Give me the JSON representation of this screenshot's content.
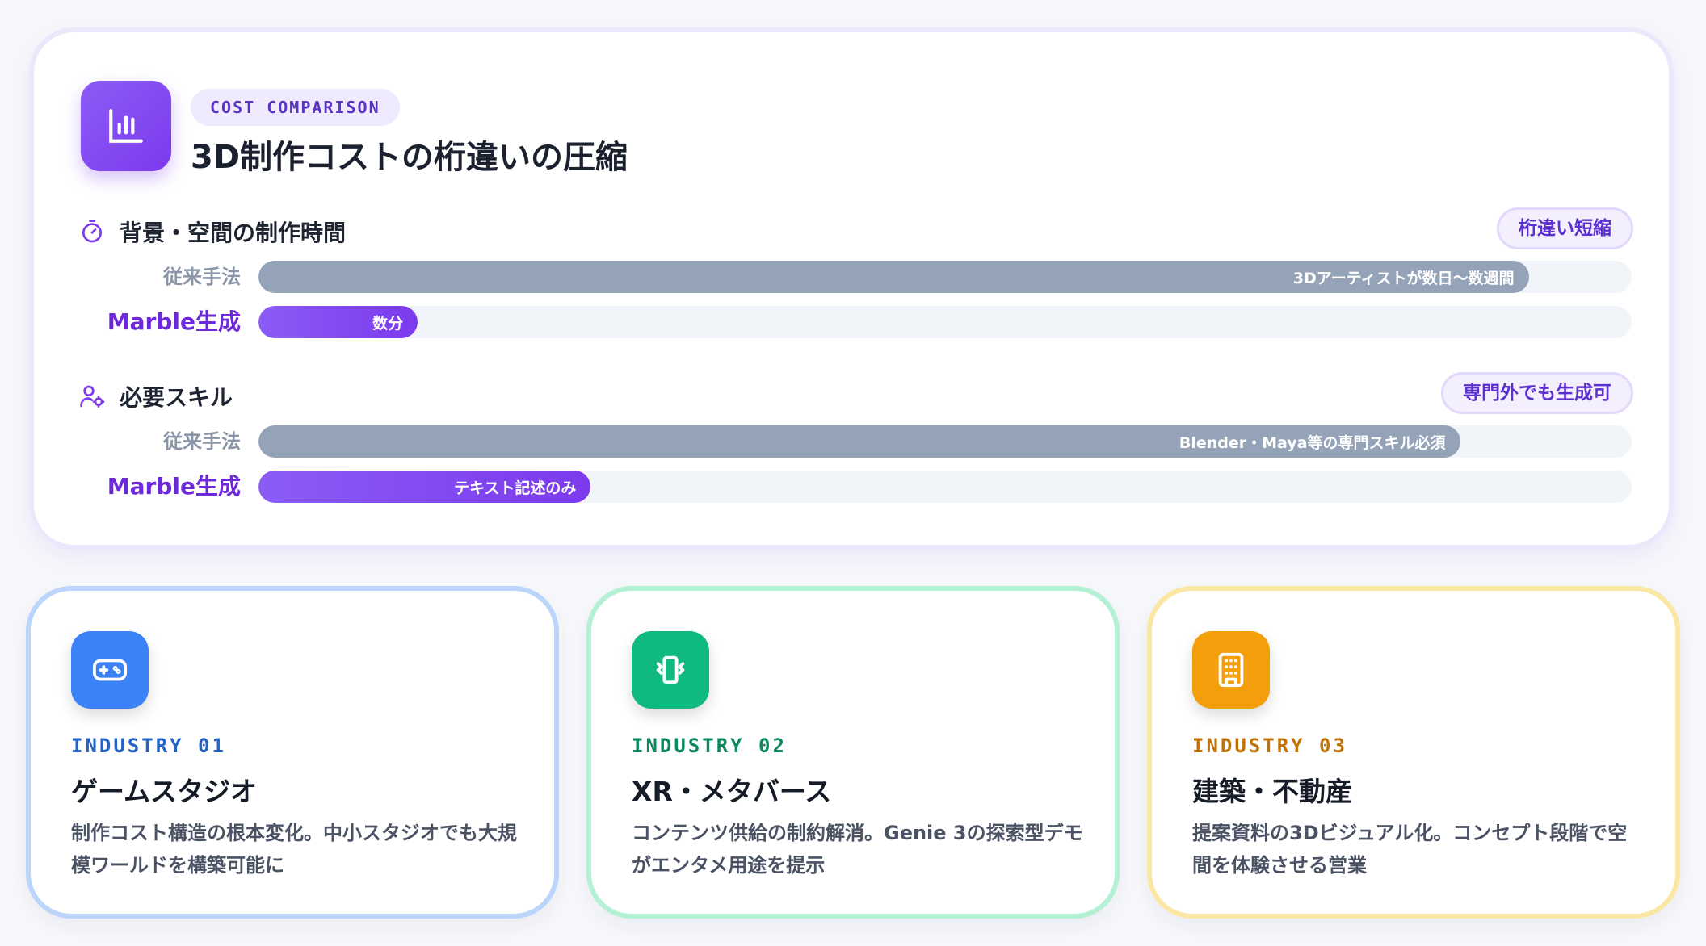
{
  "header": {
    "eyebrow": "COST COMPARISON",
    "title": "3D制作コストの桁違いの圧縮",
    "icon": "bar-chart-icon"
  },
  "sections": [
    {
      "title": "背景・空間の制作時間",
      "icon": "stopwatch-icon",
      "badge": "桁違い短縮",
      "rows": [
        {
          "label": "従来手法",
          "text": "3Dアーティストが数日〜数週間",
          "level": 0.925,
          "kind": "legacy"
        },
        {
          "label": "Marble生成",
          "text": "数分",
          "level": 0.116,
          "kind": "marble"
        }
      ]
    },
    {
      "title": "必要スキル",
      "icon": "user-gear-icon",
      "badge": "専門外でも生成可",
      "rows": [
        {
          "label": "従来手法",
          "text": "Blender・Maya等の専門スキル必須",
          "level": 0.875,
          "kind": "legacy"
        },
        {
          "label": "Marble生成",
          "text": "テキスト記述のみ",
          "level": 0.242,
          "kind": "marble"
        }
      ]
    }
  ],
  "industries": [
    {
      "tag": "INDUSTRY 01",
      "title": "ゲームスタジオ",
      "desc": "制作コスト構造の根本変化。中小スタジオでも大規模ワールドを構築可能に",
      "icon": "gamepad-icon",
      "color": "#3b82f6",
      "tag_color": "#2563c9"
    },
    {
      "tag": "INDUSTRY 02",
      "title": "XR・メタバース",
      "desc": "コンテンツ供給の制約解消。Genie 3の探索型デモがエンタメ用途を提示",
      "icon": "vibrating-phone-icon",
      "color": "#10b981",
      "tag_color": "#0d8a5d"
    },
    {
      "tag": "INDUSTRY 03",
      "title": "建築・不動産",
      "desc": "提案資料の3Dビジュアル化。コンセプト段階で空間を体験させる営業",
      "icon": "building-icon",
      "color": "#f59e0b",
      "tag_color": "#c27306"
    }
  ],
  "colors": {
    "accent": "#7c3aed",
    "legacy_bar": "#95a3b8",
    "track": "#f1f4f8"
  }
}
